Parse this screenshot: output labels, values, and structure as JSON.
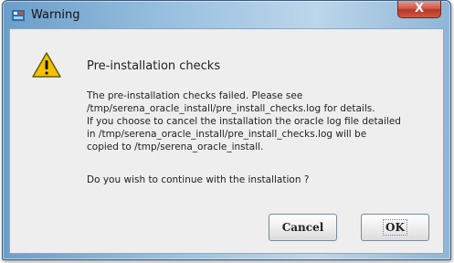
{
  "window": {
    "title": "Warning",
    "close_label": "X"
  },
  "dialog": {
    "heading": "Pre-installation checks",
    "message_lines": [
      "The pre-installation checks failed. Please see",
      "/tmp/serena_oracle_install/pre_install_checks.log for details.",
      "If you choose to cancel the installation the oracle log file detailed",
      "in /tmp/serena_oracle_install/pre_install_checks.log will be",
      "copied to /tmp/serena_oracle_install."
    ],
    "question": "Do you wish to continue with the installation ?",
    "icon": "warning-icon"
  },
  "buttons": {
    "cancel": "Cancel",
    "ok": "OK"
  },
  "colors": {
    "title_bar": "#9cc2e0",
    "close_button": "#c94a3a",
    "dialog_background": "#eeeeee",
    "warning_icon": "#f2c200"
  }
}
